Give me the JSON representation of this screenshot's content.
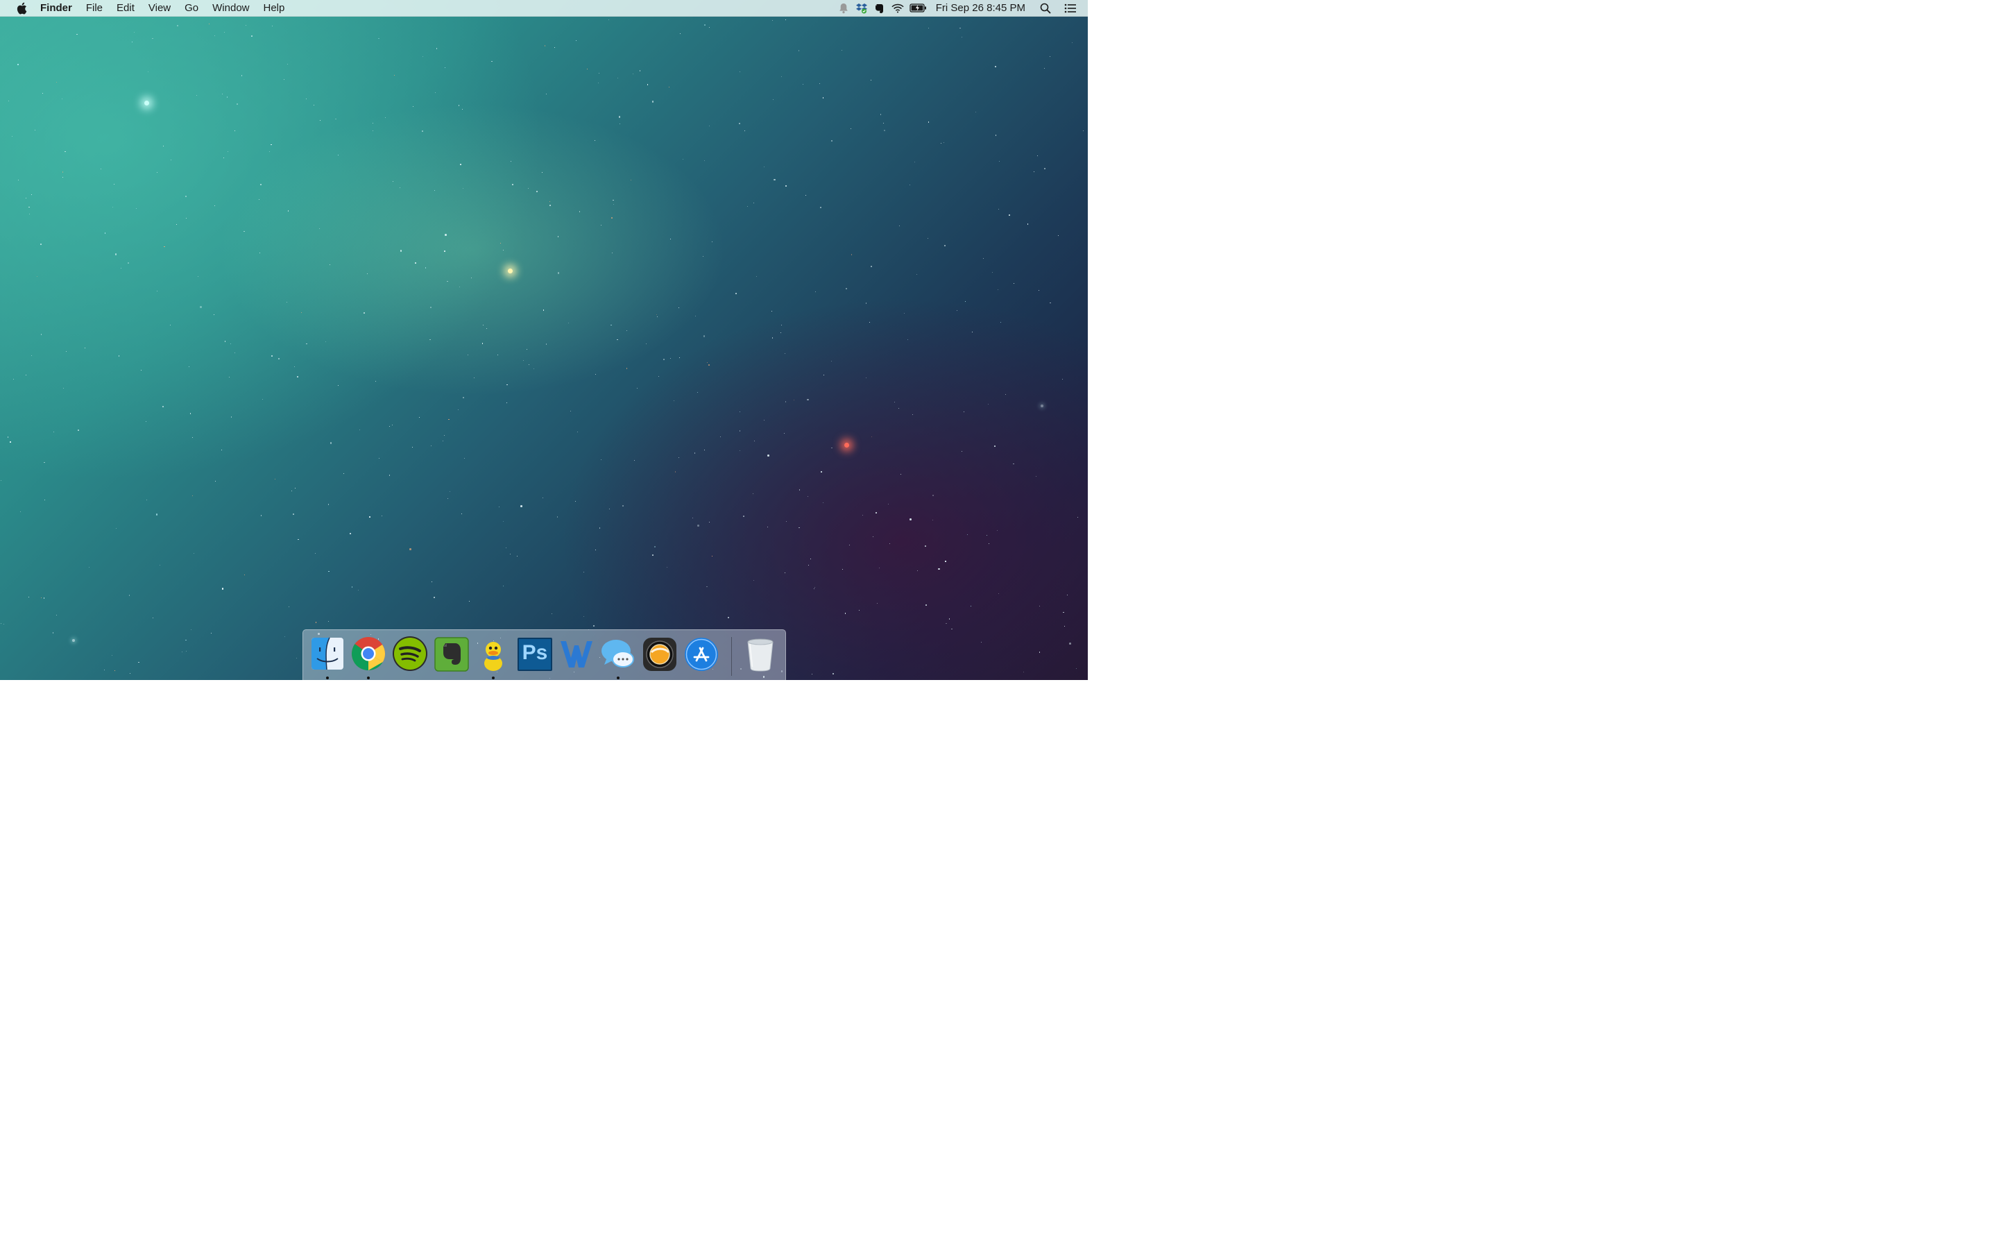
{
  "menubar": {
    "apple_icon": "apple-logo-icon",
    "app_name": "Finder",
    "menus": [
      "File",
      "Edit",
      "View",
      "Go",
      "Window",
      "Help"
    ],
    "status_icons": [
      "notification-bell-icon",
      "dropbox-icon",
      "evernote-icon",
      "wifi-icon",
      "battery-charging-icon"
    ],
    "clock": "Fri Sep 26  8:45 PM",
    "spotlight_icon": "spotlight-search-icon",
    "notification_center_icon": "notification-center-icon"
  },
  "dock": {
    "apps": [
      {
        "name": "Finder",
        "icon": "finder-icon",
        "running": true
      },
      {
        "name": "Google Chrome",
        "icon": "chrome-icon",
        "running": true
      },
      {
        "name": "Spotify",
        "icon": "spotify-icon",
        "running": false
      },
      {
        "name": "Evernote",
        "icon": "evernote-icon",
        "running": false
      },
      {
        "name": "Adium",
        "icon": "adium-duck-icon",
        "running": true
      },
      {
        "name": "Photoshop",
        "icon": "photoshop-icon",
        "running": false
      },
      {
        "name": "Microsoft Word",
        "icon": "word-icon",
        "running": false
      },
      {
        "name": "Messages",
        "icon": "messages-icon",
        "running": true
      },
      {
        "name": "Aperture",
        "icon": "aperture-lens-icon",
        "running": false
      },
      {
        "name": "App Store",
        "icon": "app-store-icon",
        "running": false
      }
    ],
    "trash": {
      "name": "Trash",
      "icon": "trash-icon"
    },
    "photoshop_label": "Ps",
    "word_label": "W"
  },
  "colors": {
    "menubar_bg": "#e8f6f4",
    "wallpaper_teal": "#3aa69a",
    "wallpaper_deep": "#1b2444"
  }
}
